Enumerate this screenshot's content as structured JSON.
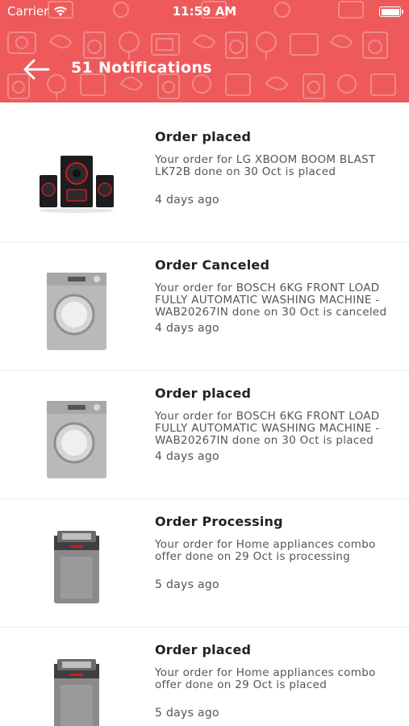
{
  "status_bar": {
    "carrier": "Carrier",
    "time": "11:59 AM"
  },
  "header": {
    "title": "51 Notifications",
    "background_color": "#ee5a5c",
    "back_icon": "arrow-left-icon"
  },
  "notifications": [
    {
      "title": "Order placed",
      "description": "Your order for LG XBOOM BOOM BLAST LK72B done on 30 Oct is placed",
      "time": "4 days ago",
      "image": "speaker-system"
    },
    {
      "title": "Order Canceled",
      "description": "Your order for BOSCH 6KG FRONT LOAD FULLY AUTOMATIC WASHING MACHINE - WAB20267IN done on 30 Oct is canceled",
      "time": "4 days ago",
      "image": "front-load-washer"
    },
    {
      "title": "Order placed",
      "description": "Your order for BOSCH 6KG FRONT LOAD FULLY AUTOMATIC WASHING MACHINE - WAB20267IN done on 30 Oct is placed",
      "time": "4 days ago",
      "image": "front-load-washer"
    },
    {
      "title": "Order Processing",
      "description": "Your order for Home appliances combo offer done on 29 Oct is processing",
      "time": "5 days ago",
      "image": "top-load-washer"
    },
    {
      "title": "Order placed",
      "description": "Your order for Home appliances combo offer done on 29 Oct is placed",
      "time": "5 days ago",
      "image": "top-load-washer"
    }
  ]
}
